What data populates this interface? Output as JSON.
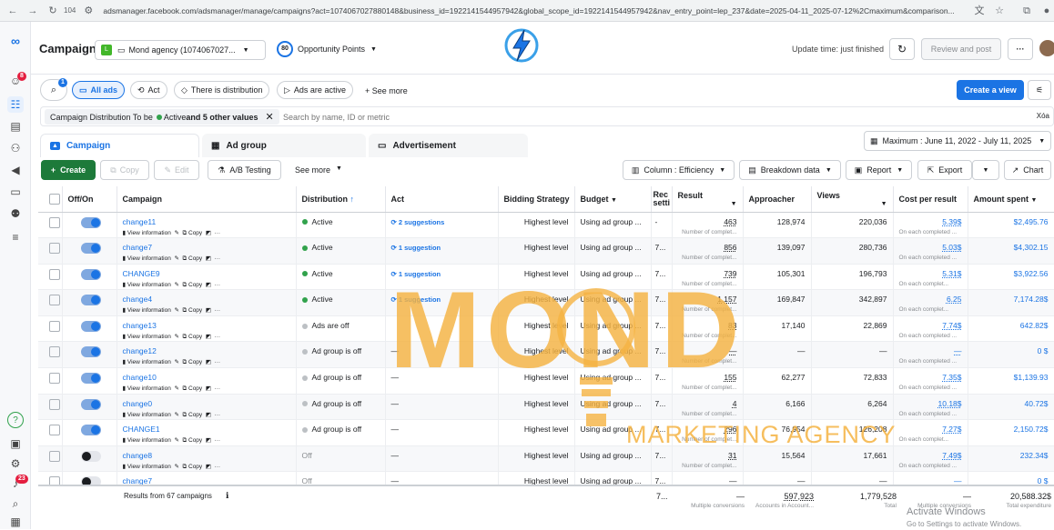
{
  "browser": {
    "tab_count": "104",
    "url": "adsmanager.facebook.com/adsmanager/manage/campaigns?act=1074067027880148&business_id=1922141544957942&global_scope_id=1922141544957942&nav_entry_point=lep_237&date=2025-04-11_2025-07-12%2Cmaximum&comparison..."
  },
  "leftnav": {
    "notif_badge": "8",
    "alerts_badge": "23"
  },
  "header": {
    "title": "Campaign",
    "account_initial": "L",
    "account_name": "Mond agency (1074067027...",
    "opportunity_score": "80",
    "opportunity_label": "Opportunity Points",
    "update_text": "Update time: just finished",
    "review_label": "Review and post"
  },
  "filters": {
    "filter_badge": "1",
    "all_ads": "All ads",
    "act": "Act",
    "distribution": "There is distribution",
    "ads_active": "Ads are active",
    "see_more": "+ See more",
    "create_view": "Create a view"
  },
  "search": {
    "chip_prefix": "Campaign Distribution To be",
    "chip_active": "Active",
    "chip_suffix": "and 5 other values",
    "placeholder": "Search by name, ID or metric",
    "right": "Xóa"
  },
  "tabs": {
    "campaign": "Campaign",
    "adgroup": "Ad group",
    "ad": "Advertisement"
  },
  "date_range": "Maximum : June 11, 2022 - July 11, 2025",
  "toolbar": {
    "create": "Create",
    "copy": "Copy",
    "edit": "Edit",
    "ab": "A/B Testing",
    "see_more": "See more",
    "column": "Column : Efficiency",
    "breakdown": "Breakdown data",
    "report": "Report",
    "export": "Export",
    "chart": "Chart"
  },
  "columns": {
    "offon": "Off/On",
    "campaign": "Campaign",
    "distribution": "Distribution",
    "act": "Act",
    "bidding": "Bidding Strategy",
    "budget": "Budget",
    "rec": "Rec setti",
    "result": "Result",
    "approacher": "Approacher",
    "views": "Views",
    "cost": "Cost per result",
    "amount": "Amount spent"
  },
  "row_actions": {
    "view": "View information",
    "copy": "Copy"
  },
  "rows": [
    {
      "name": "change11",
      "status": "Active",
      "act": "2 suggestions",
      "bid": "Highest level",
      "budget": "Using ad group ...",
      "rec": "-",
      "result": "463",
      "result_sub": "Number of complet...",
      "approacher": "128,974",
      "views": "220,036",
      "cost": "5.39$",
      "cost_sub": "On each completed ...",
      "amount": "$2,495.76"
    },
    {
      "name": "change7",
      "status": "Active",
      "act": "1 suggestion",
      "bid": "Highest level",
      "budget": "Using ad group ...",
      "rec": "7...",
      "result": "856",
      "result_sub": "Number of complet...",
      "approacher": "139,097",
      "views": "280,736",
      "cost": "5.03$",
      "cost_sub": "On each completed ...",
      "amount": "$4,302.15"
    },
    {
      "name": "CHANGE9",
      "status": "Active",
      "act": "1 suggestion",
      "bid": "Highest level",
      "budget": "Using ad group ...",
      "rec": "7...",
      "result": "739",
      "result_sub": "Number of complet...",
      "approacher": "105,301",
      "views": "196,793",
      "cost": "5.31$",
      "cost_sub": "On each complet...",
      "amount": "$3,922.56"
    },
    {
      "name": "change4",
      "status": "Active",
      "act": "1 suggestion",
      "bid": "Highest level",
      "budget": "Using ad group ...",
      "rec": "7...",
      "result": "1,157",
      "result_sub": "Number of complet...",
      "approacher": "169,847",
      "views": "342,897",
      "cost": "6.25",
      "cost_sub": "On each complet...",
      "amount": "7,174.28$"
    },
    {
      "name": "change13",
      "status": "Ads are off",
      "act": "",
      "bid": "Highest level",
      "budget": "Using ad group ...",
      "rec": "7...",
      "result": "83",
      "result_sub": "Number of complet...",
      "approacher": "17,140",
      "views": "22,869",
      "cost": "7.74$",
      "cost_sub": "On each completed ...",
      "amount": "642.82$"
    },
    {
      "name": "change12",
      "status": "Ad group is off",
      "act": "—",
      "bid": "Highest level",
      "budget": "Using ad group ...",
      "rec": "7...",
      "result": "—",
      "result_sub": "Number of complet...",
      "approacher": "—",
      "views": "—",
      "cost": "—",
      "cost_sub": "On each completed ...",
      "amount": "0 $"
    },
    {
      "name": "change10",
      "status": "Ad group is off",
      "act": "—",
      "bid": "Highest level",
      "budget": "Using ad group ...",
      "rec": "7...",
      "result": "155",
      "result_sub": "Number of complet...",
      "approacher": "62,277",
      "views": "72,833",
      "cost": "7.35$",
      "cost_sub": "On each completed ...",
      "amount": "$1,139.93"
    },
    {
      "name": "change0",
      "status": "Ad group is off",
      "act": "—",
      "bid": "Highest level",
      "budget": "Using ad group ...",
      "rec": "7...",
      "result": "4",
      "result_sub": "Number of complet...",
      "approacher": "6,166",
      "views": "6,264",
      "cost": "10.18$",
      "cost_sub": "On each completed ...",
      "amount": "40.72$"
    },
    {
      "name": "CHANGE1",
      "status": "Ad group is off",
      "act": "—",
      "bid": "Highest level",
      "budget": "Using ad group ...",
      "rec": "7...",
      "result": "296",
      "result_sub": "Number of complet...",
      "approacher": "76,954",
      "views": "126,208",
      "cost": "7.27$",
      "cost_sub": "On each complet...",
      "amount": "2,150.72$"
    },
    {
      "name": "change8",
      "status": "Off",
      "act": "—",
      "bid": "Highest level",
      "budget": "Using ad group ...",
      "rec": "7...",
      "result": "31",
      "result_sub": "Number of complet...",
      "approacher": "15,564",
      "views": "17,661",
      "cost": "7.49$",
      "cost_sub": "On each completed ...",
      "amount": "232.34$"
    },
    {
      "name": "change7",
      "status": "Off",
      "act": "—",
      "bid": "Highest level",
      "budget": "Using ad group ...",
      "rec": "7...",
      "result": "—",
      "result_sub": "",
      "approacher": "—",
      "views": "—",
      "cost": "—",
      "cost_sub": "",
      "amount": "0 $"
    }
  ],
  "footer": {
    "results": "Results from 67 campaigns",
    "rec": "7...",
    "result": "—",
    "result_sub": "Multiple conversions",
    "approacher": "597,923",
    "approacher_sub": "Accounts in Account...",
    "views": "1,779,528",
    "views_sub": "Total",
    "cost": "—",
    "cost_sub": "Multiple conversions",
    "amount": "20,588.32$",
    "amount_sub": "Total expenditure"
  },
  "watermark": {
    "logo": "MOND",
    "tagline": "MARKETING AGENCY"
  },
  "windows": {
    "line1": "Activate Windows",
    "line2": "Go to Settings to activate Windows."
  },
  "colors": {
    "accent": "#1b74e4",
    "create_green": "#1d7a3a",
    "active_green": "#31a24c",
    "watermark": "#f5b342"
  }
}
